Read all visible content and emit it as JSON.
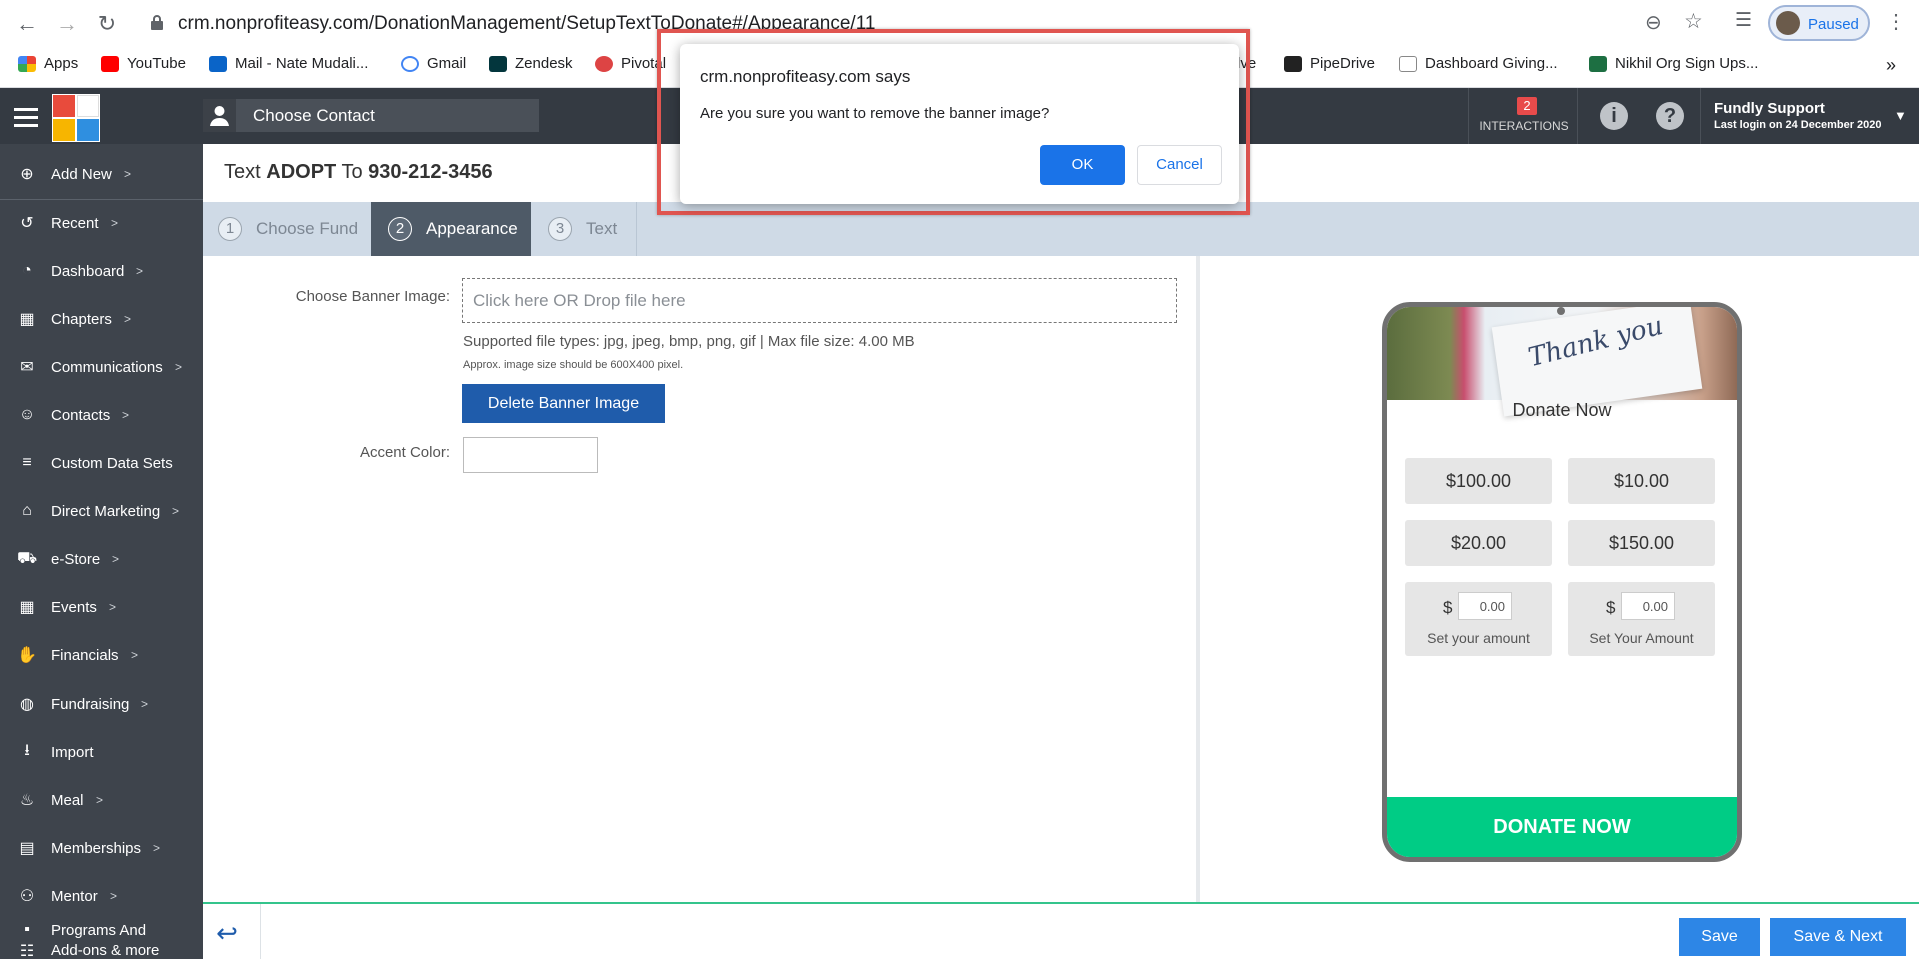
{
  "browser": {
    "url": "crm.nonprofiteasy.com/DonationManagement/SetupTextToDonate#/Appearance/11",
    "profile_status": "Paused",
    "bookmarks": [
      {
        "label": "Apps",
        "icon": "apps-grid-icon",
        "color": "#ea4335"
      },
      {
        "label": "YouTube",
        "icon": "youtube-icon",
        "color": "#ff0000"
      },
      {
        "label": "Mail - Nate Mudali...",
        "icon": "outlook-icon",
        "color": "#0a64c8"
      },
      {
        "label": "Gmail",
        "icon": "google-icon",
        "color": "#4285f4"
      },
      {
        "label": "Zendesk",
        "icon": "zendesk-icon",
        "color": "#03363d"
      },
      {
        "label": "Pivotal",
        "icon": "pivotal-icon",
        "color": "#d44"
      },
      {
        "label": "lve",
        "icon": "",
        "color": "#fff"
      },
      {
        "label": "PipeDrive",
        "icon": "pipedrive-icon",
        "color": "#222"
      },
      {
        "label": "Dashboard Giving...",
        "icon": "doc-icon",
        "color": "#888"
      },
      {
        "label": "Nikhil Org Sign Ups...",
        "icon": "excel-icon",
        "color": "#1d6f42"
      }
    ],
    "more": "»"
  },
  "header": {
    "choose_contact": "Choose Contact",
    "interactions_count": "2",
    "interactions_label": "INTERACTIONS",
    "user_name": "Fundly Support",
    "last_login": "Last login on 24 December 2020"
  },
  "sidebar": {
    "items": [
      {
        "label": "Add New",
        "icon": "plus-circle-icon",
        "chevron": ">"
      },
      {
        "label": "Recent",
        "icon": "history-icon",
        "chevron": ">"
      },
      {
        "label": "Dashboard",
        "icon": "dashboard-icon",
        "chevron": ">"
      },
      {
        "label": "Chapters",
        "icon": "grid-icon",
        "chevron": ">"
      },
      {
        "label": "Communications",
        "icon": "envelope-icon",
        "chevron": ">"
      },
      {
        "label": "Contacts",
        "icon": "user-icon",
        "chevron": ">"
      },
      {
        "label": "Custom Data Sets",
        "icon": "layers-icon",
        "chevron": ""
      },
      {
        "label": "Direct Marketing",
        "icon": "bank-icon",
        "chevron": ">"
      },
      {
        "label": "e-Store",
        "icon": "cart-icon",
        "chevron": ">"
      },
      {
        "label": "Events",
        "icon": "calendar-icon",
        "chevron": ">"
      },
      {
        "label": "Financials",
        "icon": "money-hand-icon",
        "chevron": ">"
      },
      {
        "label": "Fundraising",
        "icon": "money-bag-icon",
        "chevron": ">"
      },
      {
        "label": "Import",
        "icon": "download-icon",
        "chevron": ""
      },
      {
        "label": "Meal",
        "icon": "cutlery-icon",
        "chevron": ">"
      },
      {
        "label": "Memberships",
        "icon": "id-card-icon",
        "chevron": ">"
      },
      {
        "label": "Mentor",
        "icon": "people-icon",
        "chevron": ">"
      },
      {
        "label": "Programs And",
        "icon": "program-icon",
        "chevron": ""
      },
      {
        "label": "Add-ons & more",
        "icon": "apps-grid-icon",
        "chevron": ""
      }
    ]
  },
  "page": {
    "title_prefix": "Text ",
    "keyword": "ADOPT",
    "title_mid": " To ",
    "phone": "930-212-3456"
  },
  "tabs": [
    {
      "num": "1",
      "label": "Choose Fund"
    },
    {
      "num": "2",
      "label": "Appearance"
    },
    {
      "num": "3",
      "label": "Text"
    }
  ],
  "form": {
    "banner_label": "Choose Banner Image:",
    "dropzone_text": "Click here OR Drop file here",
    "supported_types": "Supported file types: jpg, jpeg, bmp, png, gif | Max file size: 4.00 MB",
    "size_hint": "Approx. image size should be 600X400 pixel.",
    "delete_button": "Delete Banner Image",
    "accent_label": "Accent Color:",
    "accent_value": ""
  },
  "preview": {
    "banner_script": "Thank you",
    "title": "Donate Now",
    "amounts": [
      "$100.00",
      "$10.00",
      "$20.00",
      "$150.00"
    ],
    "custom_amounts": [
      {
        "currency": "$",
        "value": "0.00",
        "label": "Set your amount"
      },
      {
        "currency": "$",
        "value": "0.00",
        "label": "Set Your Amount"
      }
    ],
    "donate_button": "DONATE NOW",
    "accent_color": "#00cc85"
  },
  "footer": {
    "save": "Save",
    "save_next": "Save & Next"
  },
  "dialog": {
    "title": "crm.nonprofiteasy.com says",
    "message": "Are you sure you want to remove the banner image?",
    "ok": "OK",
    "cancel": "Cancel"
  }
}
